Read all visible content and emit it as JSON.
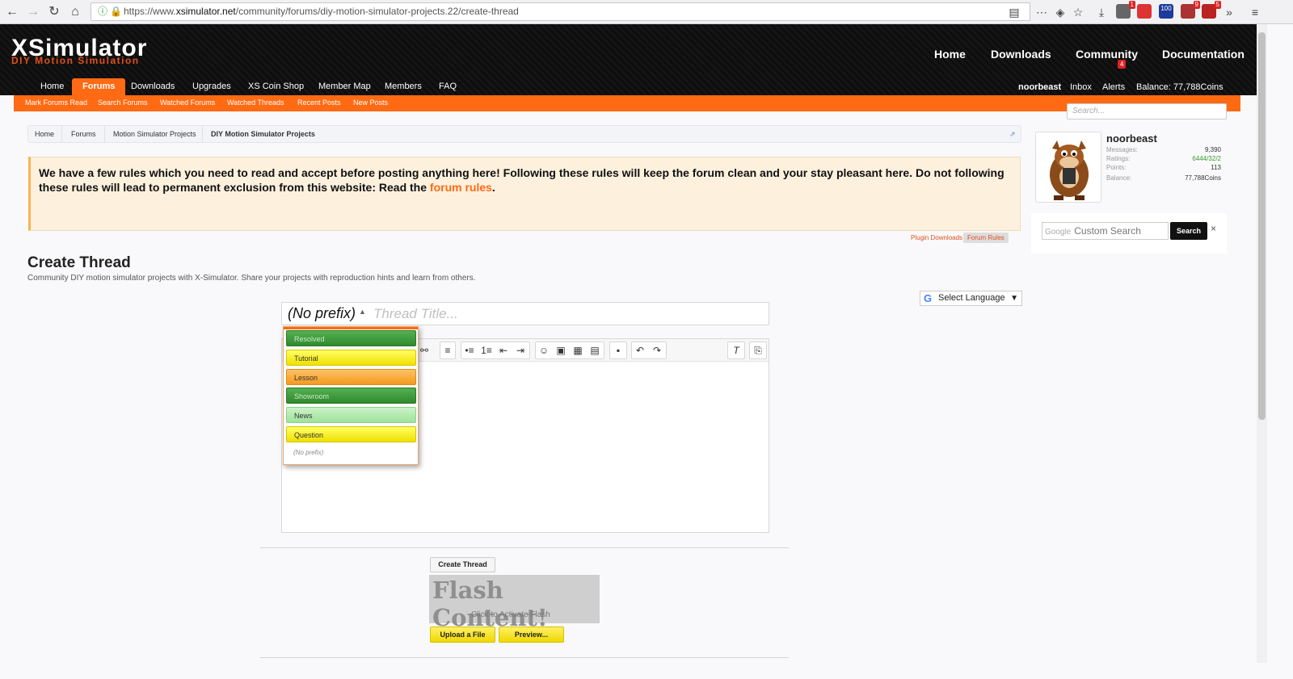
{
  "browser": {
    "url_prefix": "https://www.",
    "url_domain": "xsimulator.net",
    "url_path": "/community/forums/diy-motion-simulator-projects.22/create-thread",
    "badges": [
      "1",
      "100",
      "9",
      "5"
    ]
  },
  "logo": {
    "main": "XSimulator",
    "sub": "DIY Motion Simulation"
  },
  "topnav": [
    "Home",
    "Downloads",
    "Community",
    "Documentation"
  ],
  "mainnav": [
    "Home",
    "Forums",
    "Downloads",
    "Upgrades",
    "XS Coin Shop",
    "Member Map",
    "Members",
    "FAQ"
  ],
  "usernav": {
    "username": "noorbeast",
    "inbox": "Inbox",
    "alerts": "Alerts",
    "alerts_count": "4",
    "balance": "Balance: 77,788Coins"
  },
  "subnav": [
    "Mark Forums Read",
    "Search Forums",
    "Watched Forums",
    "Watched Threads",
    "Recent Posts",
    "New Posts"
  ],
  "search_placeholder": "Search...",
  "breadcrumb": [
    "Home",
    "Forums",
    "Motion Simulator Projects",
    "DIY Motion Simulator Projects"
  ],
  "notice": {
    "text": "We have a few rules which you need to read and accept before posting anything here! Following these rules will keep the forum clean and your stay pleasant here. Do not following these rules will lead to permanent exclusion from this website: Read the",
    "link": "forum rules",
    "end": "."
  },
  "rule_links": [
    "Plugin Downloads",
    "Forum Rules"
  ],
  "page": {
    "title": "Create Thread",
    "description": "Community DIY motion simulator projects with X-Simulator. Share your projects with reproduction hints and learn from others."
  },
  "user_card": {
    "name": "noorbeast",
    "stats": [
      {
        "label": "Messages:",
        "value": "9,390"
      },
      {
        "label": "Ratings:",
        "value": "6444/32/2"
      },
      {
        "label": "Points:",
        "value": "113"
      },
      {
        "label": "Balance:",
        "value": "77,788Coins"
      }
    ]
  },
  "google_search": {
    "brand": "Google",
    "placeholder": "Custom Search",
    "button": "Search",
    "close": "×"
  },
  "language": {
    "label": "Select Language",
    "arrow": "▼",
    "g": "G"
  },
  "thread": {
    "prefix": "(No prefix)",
    "title_placeholder": "Thread Title..."
  },
  "prefix_options": [
    "Resolved",
    "Tutorial",
    "Lesson",
    "Showroom",
    "News",
    "Question",
    "(No prefix)"
  ],
  "buttons": {
    "create": "Create Thread",
    "upload": "Upload a File",
    "preview": "Preview..."
  },
  "flash": {
    "title": "Flash Content!",
    "subtitle": "Click to Activate Flash"
  }
}
